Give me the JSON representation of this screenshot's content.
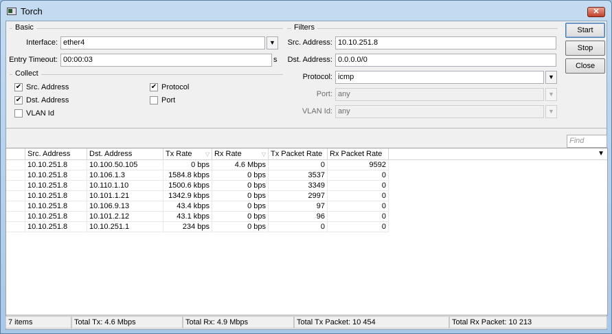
{
  "window": {
    "title": "Torch",
    "close": "✕"
  },
  "basic": {
    "group": "Basic",
    "interface_label": "Interface:",
    "interface_value": "ether4",
    "timeout_label": "Entry Timeout:",
    "timeout_value": "00:00:03",
    "timeout_unit": "s"
  },
  "collect": {
    "group": "Collect",
    "items": [
      {
        "label": "Src. Address",
        "checked": true
      },
      {
        "label": "Dst. Address",
        "checked": true
      },
      {
        "label": "VLAN Id",
        "checked": false
      },
      {
        "label": "Protocol",
        "checked": true
      },
      {
        "label": "Port",
        "checked": false
      }
    ]
  },
  "filters": {
    "group": "Filters",
    "src_label": "Src. Address:",
    "src_value": "10.10.251.8",
    "dst_label": "Dst. Address:",
    "dst_value": "0.0.0.0/0",
    "protocol_label": "Protocol:",
    "protocol_value": "icmp",
    "port_label": "Port:",
    "port_value": "any",
    "vlan_label": "VLAN Id:",
    "vlan_value": "any"
  },
  "buttons": {
    "start": "Start",
    "stop": "Stop",
    "close": "Close"
  },
  "find": {
    "placeholder": "Find"
  },
  "table": {
    "columns": [
      "Src. Address",
      "Dst. Address",
      "Tx Rate",
      "Rx Rate",
      "Tx Packet Rate",
      "Rx Packet Rate"
    ],
    "rows": [
      [
        "10.10.251.8",
        "10.100.50.105",
        "0 bps",
        "4.6 Mbps",
        "0",
        "9592"
      ],
      [
        "10.10.251.8",
        "10.106.1.3",
        "1584.8 kbps",
        "0 bps",
        "3537",
        "0"
      ],
      [
        "10.10.251.8",
        "10.110.1.10",
        "1500.6 kbps",
        "0 bps",
        "3349",
        "0"
      ],
      [
        "10.10.251.8",
        "10.101.1.21",
        "1342.9 kbps",
        "0 bps",
        "2997",
        "0"
      ],
      [
        "10.10.251.8",
        "10.106.9.13",
        "43.4 kbps",
        "0 bps",
        "97",
        "0"
      ],
      [
        "10.10.251.8",
        "10.101.2.12",
        "43.1 kbps",
        "0 bps",
        "96",
        "0"
      ],
      [
        "10.10.251.8",
        "10.10.251.1",
        "234 bps",
        "0 bps",
        "0",
        "0"
      ]
    ]
  },
  "status": {
    "items": "7 items",
    "total_tx": "Total Tx: 4.6 Mbps",
    "total_rx": "Total Rx: 4.9 Mbps",
    "total_tx_packet": "Total Tx Packet: 10 454",
    "total_rx_packet": "Total Rx Packet: 10 213"
  }
}
